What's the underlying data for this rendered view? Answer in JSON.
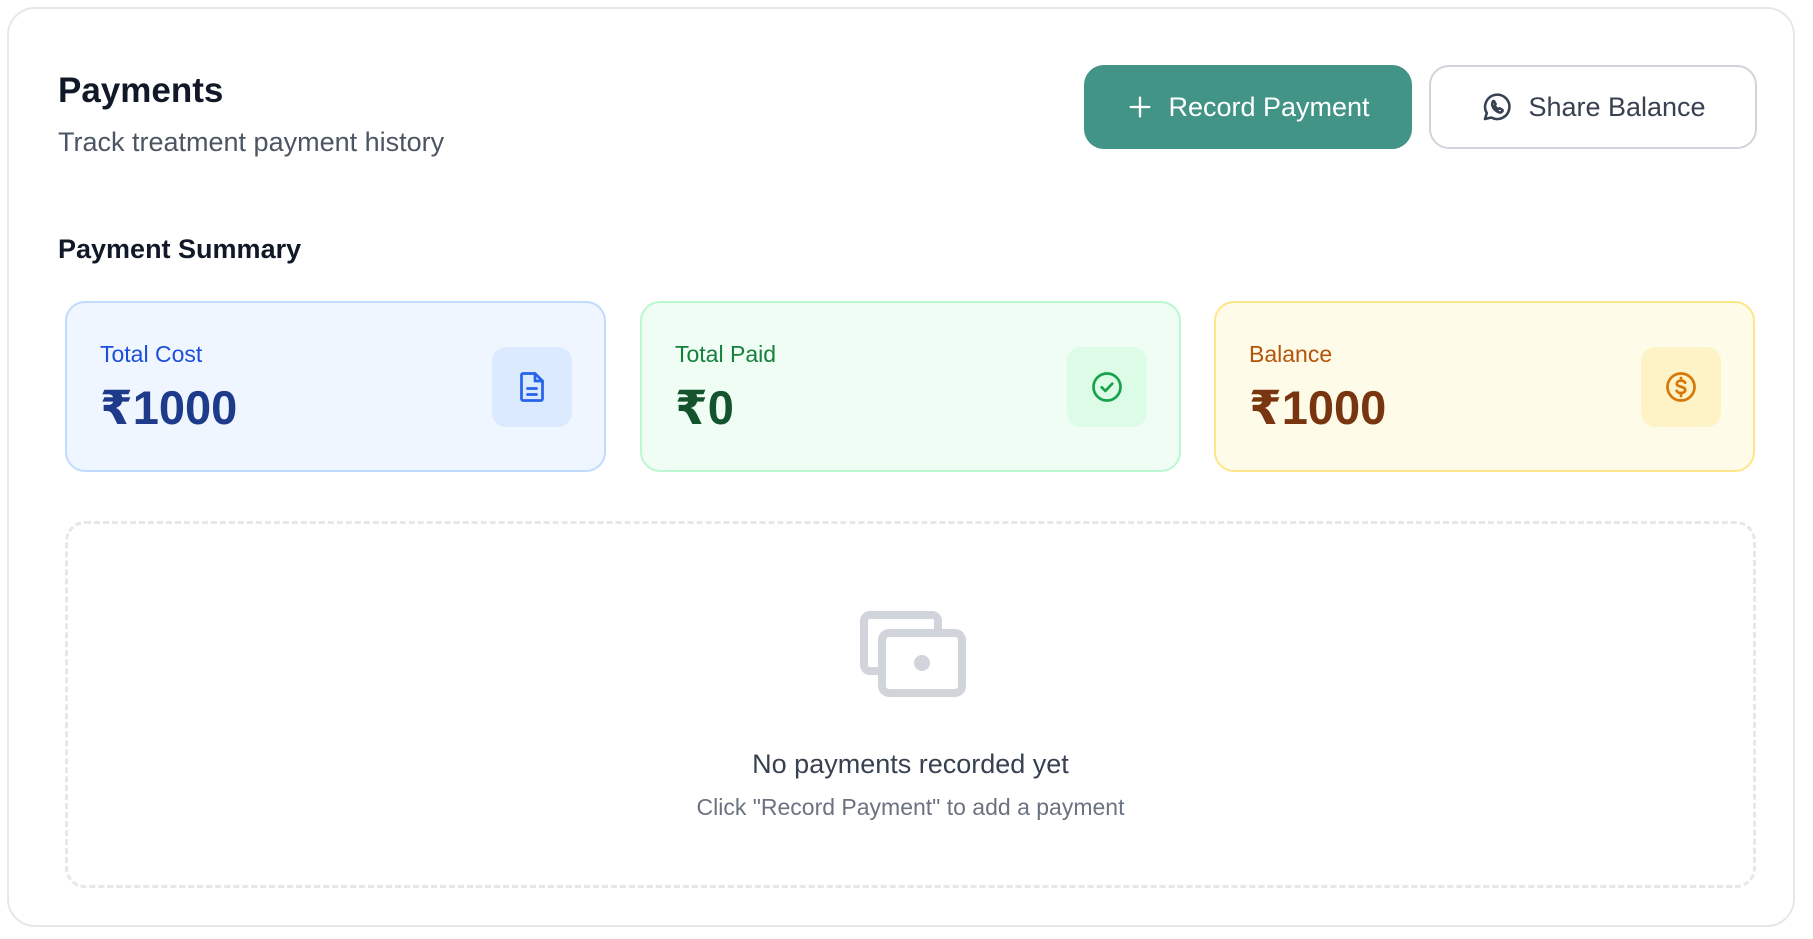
{
  "header": {
    "title": "Payments",
    "subtitle": "Track treatment payment history",
    "record_payment_label": "Record Payment",
    "share_balance_label": "Share Balance"
  },
  "summary": {
    "section_title": "Payment Summary",
    "cards": [
      {
        "label": "Total Cost",
        "value": "₹1000",
        "icon": "document-icon",
        "color": "#1e3a8a"
      },
      {
        "label": "Total Paid",
        "value": "₹0",
        "icon": "check-circle-icon",
        "color": "#14532d"
      },
      {
        "label": "Balance",
        "value": "₹1000",
        "icon": "dollar-circle-icon",
        "color": "#78350f"
      }
    ]
  },
  "empty_state": {
    "icon": "money-icon",
    "title": "No payments recorded yet",
    "subtitle": "Click \"Record Payment\" to add a payment"
  },
  "colors": {
    "primary": "#429486",
    "card_cost_bg": "#eff6ff",
    "card_paid_bg": "#f0fdf4",
    "card_balance_bg": "#fefce8"
  }
}
